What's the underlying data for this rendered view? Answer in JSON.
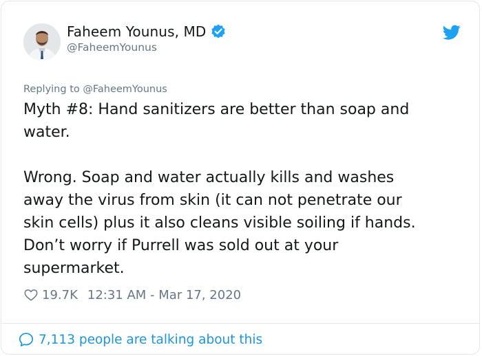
{
  "tweet": {
    "display_name": "Faheem Younus, MD",
    "handle": "@FaheemYounus",
    "replying_to": "Replying to @FaheemYounus",
    "text": "Myth #8: Hand sanitizers are better than soap and\nwater.\n\nWrong. Soap and water actually kills and washes\naway the virus from skin (it can not penetrate our\nskin cells) plus it also cleans visible soiling if hands.\nDon’t worry if Purrell was sold out at your\nsupermarket.",
    "likes": "19.7K",
    "timestamp": "12:31 AM - Mar 17, 2020",
    "talking": "7,113 people are talking about this"
  },
  "icons": {
    "verified": "verified-badge-icon",
    "logo": "twitter-bird-icon",
    "like": "heart-icon",
    "talk": "speech-bubble-icon"
  },
  "colors": {
    "brand": "#1da1f2",
    "link": "#1b95e0",
    "text": "#14171a",
    "muted": "#657786",
    "border": "#e1e8ed"
  }
}
